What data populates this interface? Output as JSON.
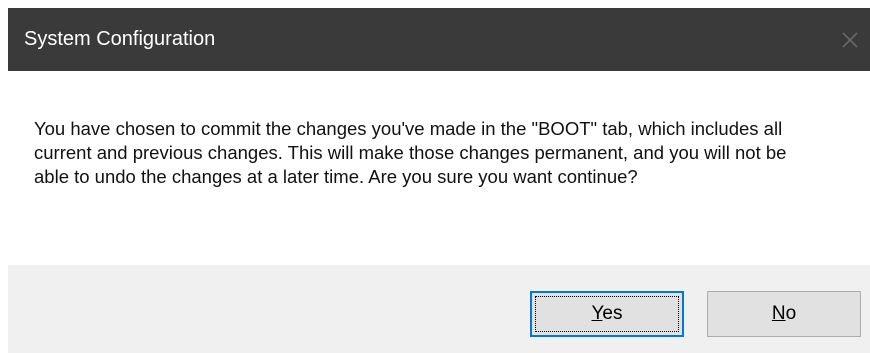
{
  "window": {
    "title": "System Configuration",
    "close_icon": "close-icon"
  },
  "message": {
    "text": "You have chosen to commit the changes you've made in the \"BOOT\" tab, which includes all current and previous changes. This will make those changes permanent, and you will not be able to undo the changes at a later time. Are you sure you want continue?"
  },
  "buttons": {
    "yes": {
      "mnemonic": "Y",
      "rest": "es",
      "focused": true
    },
    "no": {
      "mnemonic": "N",
      "rest": "o",
      "focused": false
    }
  },
  "colors": {
    "titlebar": "#3a3a3a",
    "footer": "#f0f0f0",
    "focus_accent": "#0078d7",
    "button_face": "#e1e1e1"
  }
}
